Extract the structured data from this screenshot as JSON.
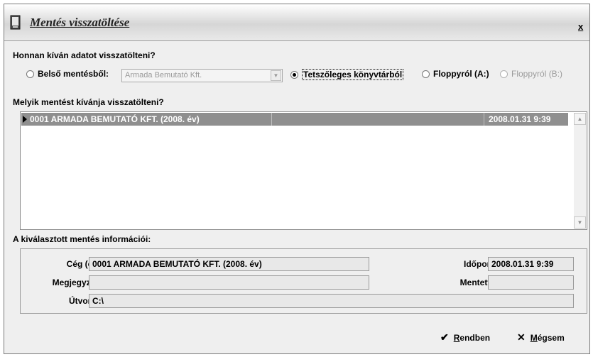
{
  "window": {
    "title": "Mentés visszatöltése",
    "close": "x"
  },
  "source": {
    "question": "Honnan kíván adatot visszatölteni?",
    "options": [
      {
        "label": "Belső mentésből:",
        "selected": false,
        "enabled": true
      },
      {
        "label": "Tetszőleges könyvtárból",
        "selected": true,
        "enabled": true
      },
      {
        "label": "Floppyról (A:)",
        "selected": false,
        "enabled": true
      },
      {
        "label": "Floppyról (B:)",
        "selected": false,
        "enabled": false
      }
    ],
    "combo_value": "Armada Bemutató Kft."
  },
  "backups": {
    "question": "Melyik mentést kívánja visszatölteni?",
    "rows": [
      {
        "name": "0001 ARMADA BEMUTATÓ KFT. (2008. év)",
        "date": "2008.01.31  9:39"
      }
    ]
  },
  "info": {
    "heading": "A kiválasztott mentés információi:",
    "company_label": "Cég (év):",
    "company_value": "0001 ARMADA BEMUTATÓ KFT. (2008. év)",
    "time_label": "Időpont:",
    "time_value": "2008.01.31  9:39",
    "note_label": "Megjegyzés:",
    "note_value": "",
    "saved_by_label": "Mentette:",
    "saved_by_value": "",
    "path_label": "Útvonal:",
    "path_value": "C:\\"
  },
  "buttons": {
    "ok_first": "R",
    "ok_rest": "endben",
    "cancel_first": "M",
    "cancel_rest": "égsem"
  },
  "icons": {
    "title": "document-icon",
    "ok": "checkmark-icon",
    "cancel": "x-icon"
  }
}
